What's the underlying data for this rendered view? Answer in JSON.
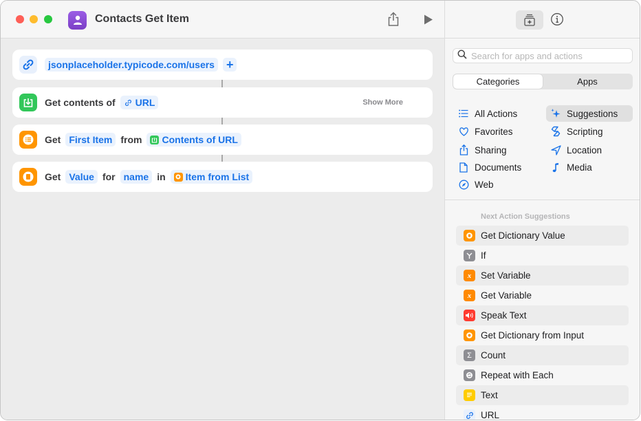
{
  "window": {
    "title": "Contacts Get Item",
    "app_icon": "person-icon"
  },
  "toolbar": {
    "share_icon": "share-icon",
    "run_icon": "play-icon",
    "library_icon": "action-library-icon",
    "info_icon": "info-icon"
  },
  "actions": [
    {
      "icon": "link-icon",
      "icon_color": "#e8f0fc",
      "url_value": "jsonplaceholder.typicode.com/users",
      "add_label": "+"
    },
    {
      "icon": "download-icon",
      "icon_color": "#32c75a",
      "prefix": "Get contents of",
      "token": "URL",
      "show_more": "Show More"
    },
    {
      "icon": "list-icon",
      "icon_color": "#ff9500",
      "prefix": "Get",
      "token1": "First Item",
      "middle": "from",
      "token2": "Contents of URL"
    },
    {
      "icon": "dictionary-icon",
      "icon_color": "#ff9500",
      "prefix": "Get",
      "token1": "Value",
      "middle1": "for",
      "token2": "name",
      "middle2": "in",
      "token3": "Item from List"
    }
  ],
  "sidebar": {
    "search_placeholder": "Search for apps and actions",
    "search_value": "",
    "tabs": [
      {
        "label": "Categories",
        "active": true
      },
      {
        "label": "Apps",
        "active": false
      }
    ],
    "categories": [
      {
        "label": "All Actions",
        "icon": "list-icon"
      },
      {
        "label": "Suggestions",
        "icon": "sparkles-icon",
        "active": true
      },
      {
        "label": "Favorites",
        "icon": "heart-icon"
      },
      {
        "label": "Scripting",
        "icon": "scripting-icon"
      },
      {
        "label": "Sharing",
        "icon": "share-icon"
      },
      {
        "label": "Location",
        "icon": "location-icon"
      },
      {
        "label": "Documents",
        "icon": "document-icon"
      },
      {
        "label": "Media",
        "icon": "music-note-icon"
      },
      {
        "label": "Web",
        "icon": "compass-icon"
      }
    ],
    "suggestions_heading": "Next Action Suggestions",
    "suggestions": [
      {
        "label": "Get Dictionary Value",
        "icon": "dictionary-icon",
        "color": "#ff9500"
      },
      {
        "label": "If",
        "icon": "branch-icon",
        "color": "#8e8e93"
      },
      {
        "label": "Set Variable",
        "icon": "variable-icon",
        "color": "#ff8a00"
      },
      {
        "label": "Get Variable",
        "icon": "variable-icon",
        "color": "#ff8a00"
      },
      {
        "label": "Speak Text",
        "icon": "speaker-icon",
        "color": "#ff3b30"
      },
      {
        "label": "Get Dictionary from Input",
        "icon": "dictionary-icon",
        "color": "#ff9500"
      },
      {
        "label": "Count",
        "icon": "sigma-icon",
        "color": "#8e8e93"
      },
      {
        "label": "Repeat with Each",
        "icon": "repeat-icon",
        "color": "#8e8e93"
      },
      {
        "label": "Text",
        "icon": "text-icon",
        "color": "#ffcc00"
      },
      {
        "label": "URL",
        "icon": "link-icon",
        "color": "#e8f0fc"
      }
    ]
  },
  "colors": {
    "accent": "#1a73e8",
    "token_bg": "#eaf2fd"
  }
}
